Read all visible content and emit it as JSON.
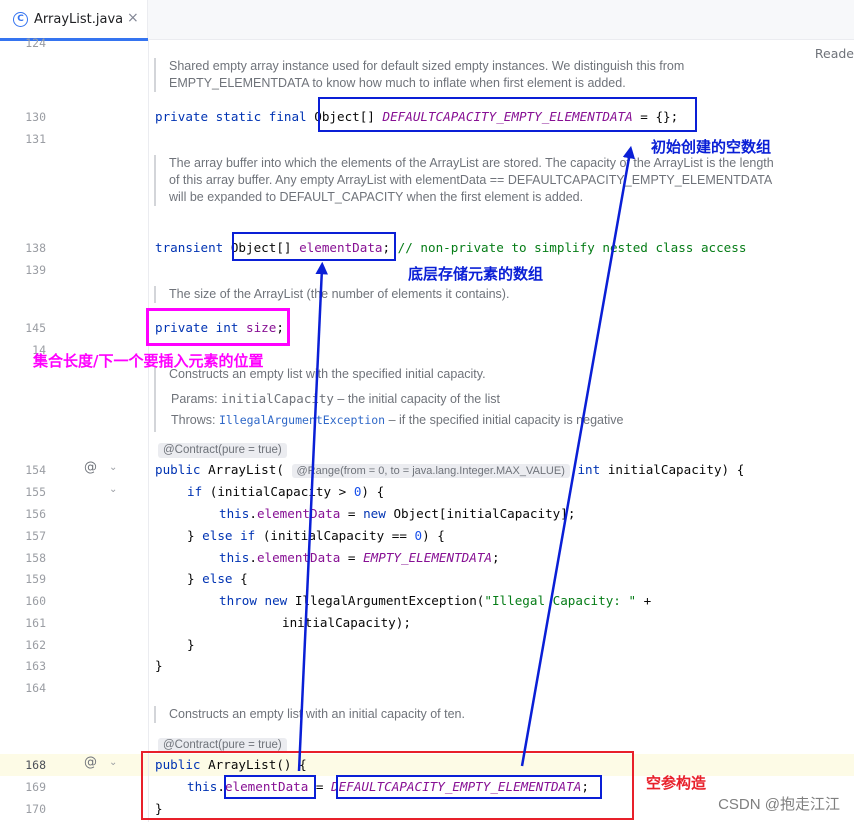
{
  "tab": {
    "icon": "C",
    "label": "ArrayList.java",
    "close": "×"
  },
  "reader_mode_label": "Reade",
  "gutter": [
    "124",
    "130",
    "131",
    "138",
    "139",
    "145",
    "14",
    "154",
    "155",
    "156",
    "157",
    "158",
    "159",
    "160",
    "161",
    "162",
    "163",
    "164",
    "168",
    "169",
    "170"
  ],
  "gutter_icons": {
    "override_icon": "@",
    "fold_icon": "⌄"
  },
  "docs": {
    "empty_instances": "Shared empty array instance used for default sized empty instances. We distinguish this from EMPTY_ELEMENTDATA to know how much to inflate when first element is added.",
    "array_buffer": "The array buffer into which the elements of the ArrayList are stored. The capacity of the ArrayList is the length of this array buffer. Any empty ArrayList with elementData == DEFAULTCAPACITY_EMPTY_ELEMENTDATA will be expanded to DEFAULT_CAPACITY when the first element is added.",
    "size": "The size of the ArrayList (the number of elements it contains).",
    "ctor_capacity": "Constructs an empty list with the specified initial capacity.",
    "params_label": "Params:",
    "params_name": "initialCapacity",
    "params_desc": " – the initial capacity of the list",
    "throws_label": "Throws:",
    "throws_name": "IllegalArgumentException",
    "throws_desc": " – if the specified initial capacity is negative",
    "contract_1": "@Contract(pure = true)",
    "ctor_default": "Constructs an empty list with an initial capacity of ten.",
    "contract_2": "@Contract(pure = true)"
  },
  "code": {
    "l130_kw": "private static final ",
    "l130_type": "Object[] ",
    "l130_const": "DEFAULTCAPACITY_EMPTY_ELEMENTDATA",
    "l130_rest": " = {};",
    "l138_kw": "transient ",
    "l138_type": "Object[] ",
    "l138_field": "elementData",
    "l138_semi": "; ",
    "l138_comment": "// non-private to simplify nested class access",
    "l145_kw": "private int ",
    "l145_field": "size",
    "l145_semi": ";",
    "l154_kw": "public ",
    "l154_name": "ArrayList(",
    "l154_hint": "@Range(from = 0, to = java.lang.Integer.MAX_VALUE)",
    "l154_kw2": " int ",
    "l154_param": "initialCapacity) {",
    "l155_kw": "if ",
    "l155_a": "(initialCapacity > ",
    "l155_num": "0",
    "l155_b": ") {",
    "l156_kw": "this",
    "l156_dot": ".",
    "l156_field": "elementData",
    "l156_eq": " = ",
    "l156_new": "new ",
    "l156_rest": "Object[initialCapacity];",
    "l157_a": "} ",
    "l157_kw": "else if ",
    "l157_b": "(initialCapacity == ",
    "l157_num": "0",
    "l157_c": ") {",
    "l158_kw": "this",
    "l158_dot": ".",
    "l158_field": "elementData",
    "l158_eq": " = ",
    "l158_const": "EMPTY_ELEMENTDATA",
    "l158_semi": ";",
    "l159_a": "} ",
    "l159_kw": "else ",
    "l159_b": "{",
    "l160_kw": "throw new ",
    "l160_a": "IllegalArgumentException(",
    "l160_str": "\"Illegal Capacity: \"",
    "l160_b": " +",
    "l161": "initialCapacity);",
    "l162": "}",
    "l163": "}",
    "l168_kw": "public ",
    "l168_name": "ArrayList",
    "l168_rest": "() {",
    "l169_kw": "this",
    "l169_dot": ".",
    "l169_field": "elementData",
    "l169_eq": " = ",
    "l169_const": "DEFAULTCAPACITY_EMPTY_ELEMENTDATA",
    "l169_semi": ";",
    "l170": "}"
  },
  "annotations": {
    "empty_array": "初始创建的空数组",
    "storage_array": "底层存储元素的数组",
    "size_note": "集合长度/下一个要插入元素的位置",
    "no_arg_ctor": "空参构造"
  },
  "annotation_colors": {
    "blue": "#0a1fd6",
    "magenta": "#ff00ff",
    "red": "#e8202a"
  },
  "watermark": "CSDN @抱走江江"
}
